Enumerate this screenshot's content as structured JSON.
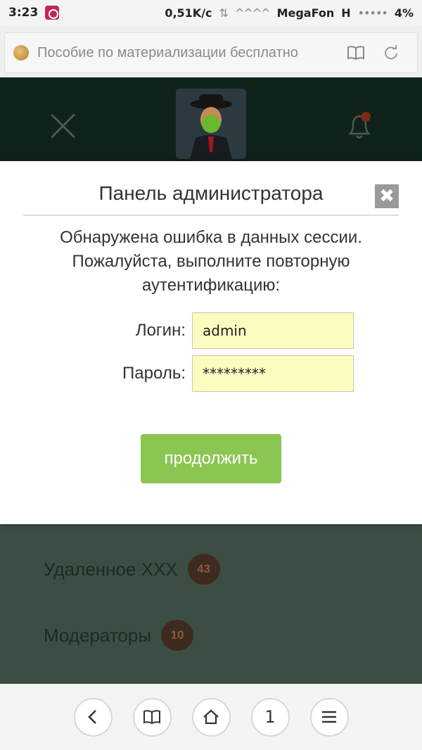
{
  "status_bar": {
    "time": "3:23",
    "speed": "0,51K/c",
    "carrier": "MegaFon",
    "network": "H",
    "battery": "4%",
    "signal": "•••••",
    "wave": "^^^^"
  },
  "browser": {
    "page_title": "Пособие по материализации бесплатно",
    "icons": {
      "site": "site-favicon",
      "reader": "book-icon",
      "reload": "reload-icon"
    }
  },
  "header": {
    "close_icon": "close-icon",
    "avatar": "avatar",
    "bell_icon": "notification-bell-icon",
    "notification_dot_color": "#c0391c"
  },
  "menu": {
    "items": [
      {
        "label": "Удаленное XXX",
        "count": "43"
      },
      {
        "label": "Модераторы",
        "count": "10"
      }
    ]
  },
  "modal": {
    "title": "Панель администратора",
    "close_symbol": "✖",
    "message": "Обнаружена ошибка в данных сессии. Пожалуйста, выполните повторную аутентификацию:",
    "login_label": "Логин:",
    "login_value": "admin",
    "password_label": "Пароль:",
    "password_value": "*********",
    "submit_label": "продолжить",
    "submit_color": "#8bc652"
  },
  "bottom_nav": {
    "back": "‹",
    "tabs_count": "1"
  }
}
